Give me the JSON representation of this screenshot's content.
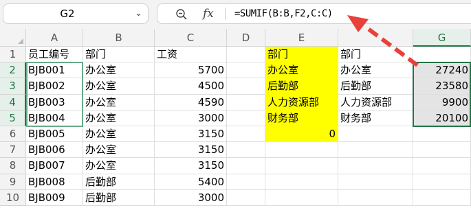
{
  "name_box": {
    "value": "G2"
  },
  "formula_bar": {
    "formula": "=SUMIF(B:B,F2,C:C)",
    "fx_label": "fx"
  },
  "columns": [
    "A",
    "B",
    "C",
    "D",
    "E",
    "",
    "G"
  ],
  "rows": [
    "1",
    "2",
    "3",
    "4",
    "5",
    "6",
    "7",
    "8",
    "9",
    "10"
  ],
  "cells": {
    "A": [
      "员工编号",
      "BJB001",
      "BJB002",
      "BJB003",
      "BJB004",
      "BJB005",
      "BJB006",
      "BJB007",
      "BJB008",
      "BJB009"
    ],
    "B": [
      "部门",
      "办公室",
      "办公室",
      "办公室",
      "办公室",
      "办公室",
      "办公室",
      "办公室",
      "后勤部",
      "后勤部"
    ],
    "C": [
      "工资",
      "5700",
      "4500",
      "4590",
      "3000",
      "3150",
      "3150",
      "3150",
      "5400",
      "3000"
    ],
    "E": [
      "部门",
      "办公室",
      "后勤部",
      "人力资源部",
      "财务部",
      "0"
    ],
    "F": [
      "部门",
      "办公室",
      "后勤部",
      "人力资源部",
      "财务部"
    ],
    "G": [
      "",
      "27240",
      "23580",
      "9900",
      "20100"
    ]
  },
  "colors": {
    "highlight": "#ffff00",
    "selection_border": "#217346",
    "arrow": "#e8403a"
  }
}
